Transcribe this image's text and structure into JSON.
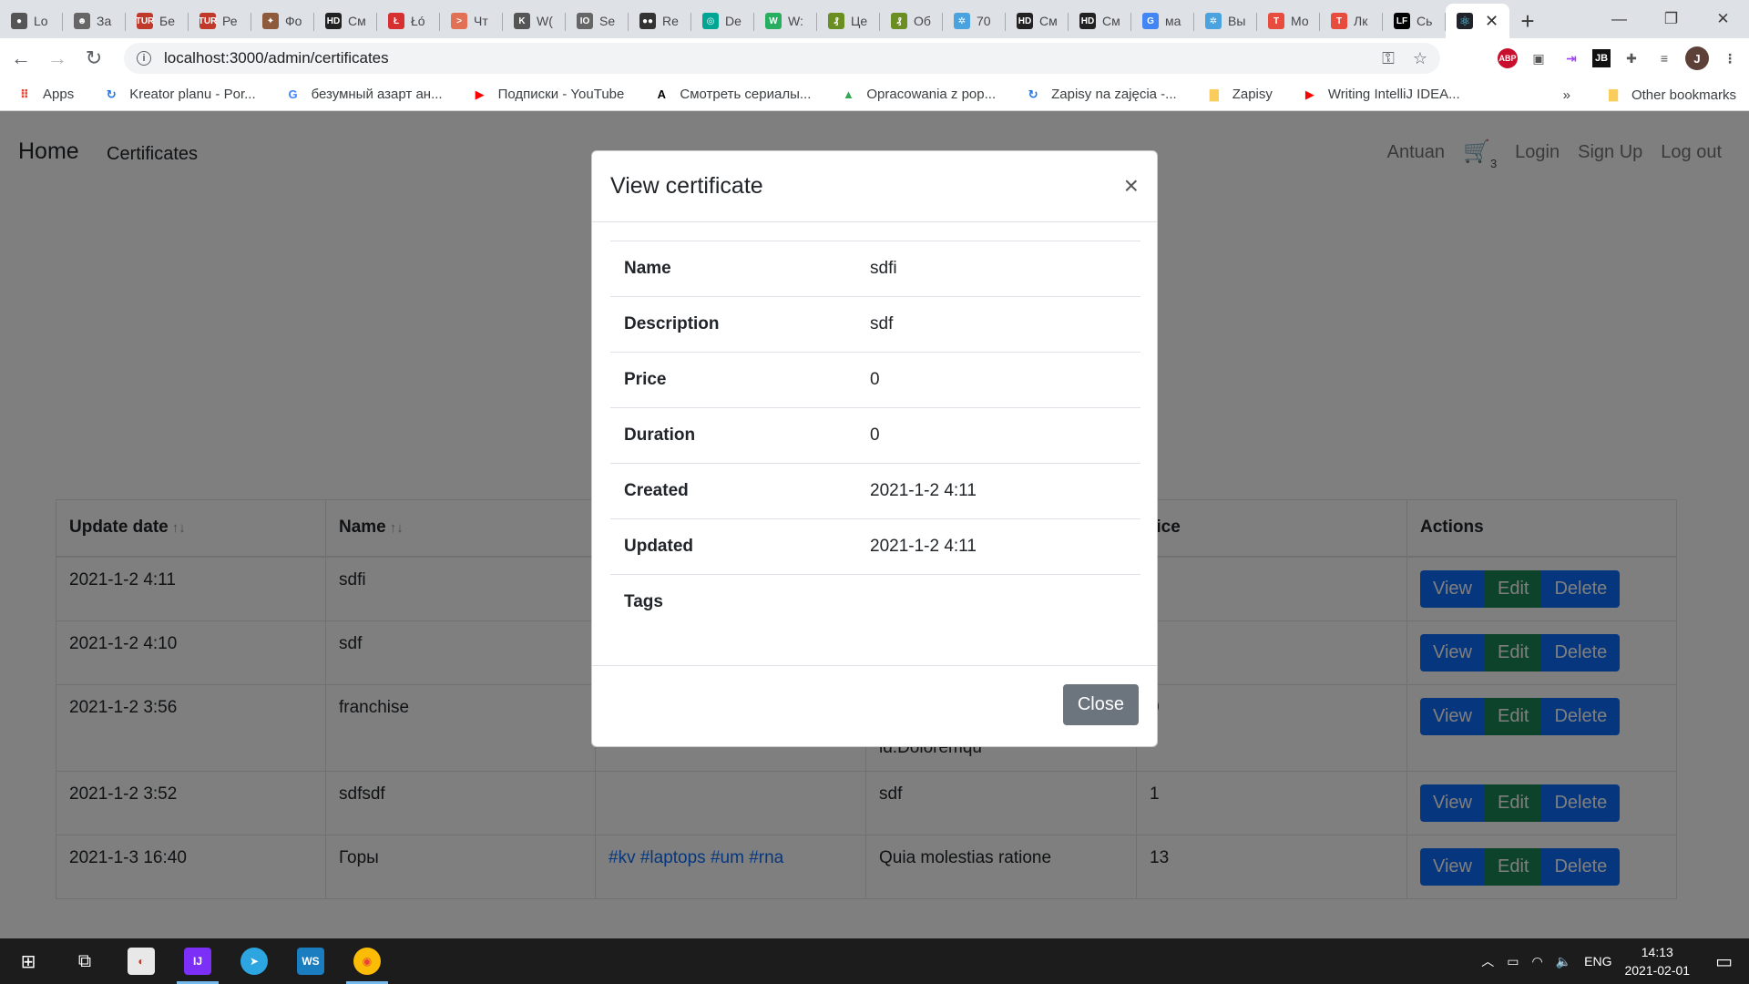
{
  "browser": {
    "tabs": [
      {
        "label": "Lo",
        "color": "#555555",
        "glyph": "●"
      },
      {
        "label": "За",
        "color": "#666666",
        "glyph": "☻"
      },
      {
        "label": "Бе",
        "color": "#c0392b",
        "glyph": "TUR"
      },
      {
        "label": "Ре",
        "color": "#c0392b",
        "glyph": "TUR"
      },
      {
        "label": "Фо",
        "color": "#8e5a3c",
        "glyph": "✦"
      },
      {
        "label": "См",
        "color": "#222222",
        "glyph": "HD"
      },
      {
        "label": "Łó",
        "color": "#d63031",
        "glyph": "Ł"
      },
      {
        "label": "Чт",
        "color": "#e17055",
        "glyph": ">"
      },
      {
        "label": "W(",
        "color": "#555555",
        "glyph": "K"
      },
      {
        "label": "Se",
        "color": "#666666",
        "glyph": "IO"
      },
      {
        "label": "Re",
        "color": "#333333",
        "glyph": "●●"
      },
      {
        "label": "De",
        "color": "#00a693",
        "glyph": "◎"
      },
      {
        "label": "W:",
        "color": "#27ae60",
        "glyph": "W"
      },
      {
        "label": "Це",
        "color": "#6b8e23",
        "glyph": "₰"
      },
      {
        "label": "Об",
        "color": "#6b8e23",
        "glyph": "₰"
      },
      {
        "label": "70",
        "color": "#4aa3df",
        "glyph": "✲"
      },
      {
        "label": "См",
        "color": "#222222",
        "glyph": "HD"
      },
      {
        "label": "См",
        "color": "#222222",
        "glyph": "HD"
      },
      {
        "label": "ма",
        "color": "#4285f4",
        "glyph": "G"
      },
      {
        "label": "Вы",
        "color": "#4aa3df",
        "glyph": "✲"
      },
      {
        "label": "Мо",
        "color": "#e74c3c",
        "glyph": "T"
      },
      {
        "label": "Лк",
        "color": "#e74c3c",
        "glyph": "T"
      },
      {
        "label": "Сь",
        "color": "#000000",
        "glyph": "LF"
      }
    ],
    "active_tab_glyph": "⚛",
    "new_tab": "+",
    "url": "localhost:3000/admin/certificates",
    "bookmarks": [
      {
        "label": "Apps",
        "icon": "apps-grid-icon",
        "glyph": "⠿",
        "color": "#e94235"
      },
      {
        "label": "Kreator planu - Por...",
        "icon": "kreator-icon",
        "glyph": "↻",
        "color": "#1a73e8"
      },
      {
        "label": "безумный азарт ан...",
        "icon": "google-icon",
        "glyph": "G",
        "color": "#4285f4"
      },
      {
        "label": "Подписки - YouTube",
        "icon": "youtube-icon",
        "glyph": "▶",
        "color": "#ff0000"
      },
      {
        "label": "Смотреть сериалы...",
        "icon": "a-icon",
        "glyph": "A",
        "color": "#000000"
      },
      {
        "label": "Opracowania z pop...",
        "icon": "drive-icon",
        "glyph": "▲",
        "color": "#34a853"
      },
      {
        "label": "Zapisy na zajęcia -...",
        "icon": "usos-icon",
        "glyph": "↻",
        "color": "#1a73e8"
      },
      {
        "label": "Zapisy",
        "icon": "folder-icon",
        "glyph": "▇",
        "color": "#f9cc5b"
      },
      {
        "label": "Writing IntelliJ IDEA...",
        "icon": "youtube-icon",
        "glyph": "▶",
        "color": "#ff0000"
      }
    ],
    "other_bookmarks": "Other bookmarks",
    "overflow": "»"
  },
  "app": {
    "brand": "Home",
    "nav_certificates": "Certificates",
    "user": "Antuan",
    "cart_count": "3",
    "login": "Login",
    "signup": "Sign Up",
    "logout": "Log out"
  },
  "table": {
    "headers": {
      "update_date": "Update date",
      "name": "Name",
      "price": "rice",
      "actions": "Actions"
    },
    "sort_glyph": "↑↓",
    "rows": [
      {
        "date": "2021-1-2 4:11",
        "name": "sdfi",
        "tags": "",
        "desc": "",
        "price": ""
      },
      {
        "date": "2021-1-2 4:10",
        "name": "sdf",
        "tags": "",
        "desc": "",
        "price": ""
      },
      {
        "date": "2021-1-2 3:56",
        "name": "franchise",
        "tags": "",
        "desc": "eligendi.Reiciendis labore in nihil autem repudiandae sequi id.Doloremqu",
        "price": "0"
      },
      {
        "date": "2021-1-2 3:52",
        "name": "sdfsdf",
        "tags": "",
        "desc": "sdf",
        "price": "1"
      },
      {
        "date": "2021-1-3 16:40",
        "name": "Горы",
        "tags": "#kv #laptops #um #rna",
        "desc": "Quia molestias ratione",
        "price": "13"
      }
    ],
    "btn_view": "View",
    "btn_edit": "Edit",
    "btn_delete": "Delete"
  },
  "modal": {
    "title": "View certificate",
    "close_x": "×",
    "fields": [
      {
        "key": "Name",
        "value": "sdfi"
      },
      {
        "key": "Description",
        "value": "sdf"
      },
      {
        "key": "Price",
        "value": "0"
      },
      {
        "key": "Duration",
        "value": "0"
      },
      {
        "key": "Created",
        "value": "2021-1-2 4:11"
      },
      {
        "key": "Updated",
        "value": "2021-1-2 4:11"
      },
      {
        "key": "Tags",
        "value": ""
      }
    ],
    "close_button": "Close"
  },
  "taskbar": {
    "lang": "ENG",
    "time": "14:13",
    "date": "2021-02-01"
  }
}
